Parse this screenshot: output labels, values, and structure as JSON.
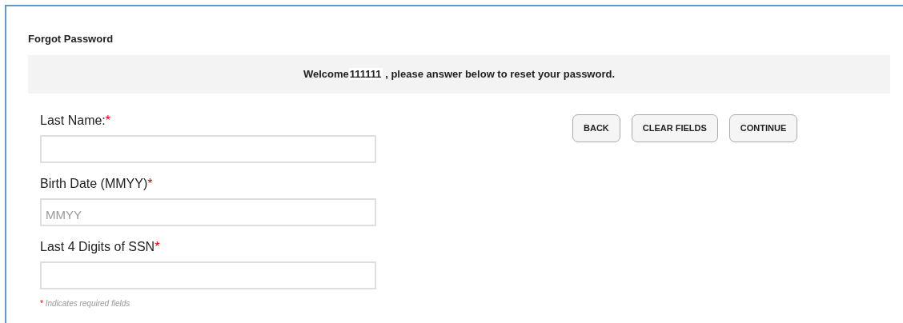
{
  "title": "Forgot Password",
  "banner": {
    "greeting": "Welcome",
    "user_name": "111111",
    "message": " , please answer below to reset your password."
  },
  "fields": [
    {
      "label": "Last Name:",
      "required_mark": "*"
    },
    {
      "label": "Birth Date (MMYY)",
      "required_mark": "*",
      "placeholder": "MMYY"
    },
    {
      "label": "Last 4 Digits of SSN",
      "required_mark": "*"
    }
  ],
  "buttons": [
    "BACK",
    "CLEAR FIELDS",
    "CONTINUE"
  ],
  "footnote": {
    "mark": "*",
    "text": "Indicates required fields"
  }
}
